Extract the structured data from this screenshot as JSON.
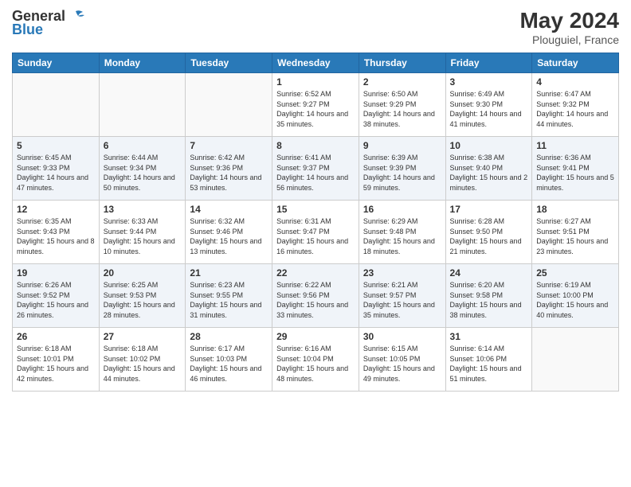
{
  "header": {
    "logo_general": "General",
    "logo_blue": "Blue",
    "month_year": "May 2024",
    "location": "Plouguiel, France"
  },
  "weekdays": [
    "Sunday",
    "Monday",
    "Tuesday",
    "Wednesday",
    "Thursday",
    "Friday",
    "Saturday"
  ],
  "weeks": [
    [
      {
        "day": "",
        "info": ""
      },
      {
        "day": "",
        "info": ""
      },
      {
        "day": "",
        "info": ""
      },
      {
        "day": "1",
        "info": "Sunrise: 6:52 AM\nSunset: 9:27 PM\nDaylight: 14 hours and 35 minutes."
      },
      {
        "day": "2",
        "info": "Sunrise: 6:50 AM\nSunset: 9:29 PM\nDaylight: 14 hours and 38 minutes."
      },
      {
        "day": "3",
        "info": "Sunrise: 6:49 AM\nSunset: 9:30 PM\nDaylight: 14 hours and 41 minutes."
      },
      {
        "day": "4",
        "info": "Sunrise: 6:47 AM\nSunset: 9:32 PM\nDaylight: 14 hours and 44 minutes."
      }
    ],
    [
      {
        "day": "5",
        "info": "Sunrise: 6:45 AM\nSunset: 9:33 PM\nDaylight: 14 hours and 47 minutes."
      },
      {
        "day": "6",
        "info": "Sunrise: 6:44 AM\nSunset: 9:34 PM\nDaylight: 14 hours and 50 minutes."
      },
      {
        "day": "7",
        "info": "Sunrise: 6:42 AM\nSunset: 9:36 PM\nDaylight: 14 hours and 53 minutes."
      },
      {
        "day": "8",
        "info": "Sunrise: 6:41 AM\nSunset: 9:37 PM\nDaylight: 14 hours and 56 minutes."
      },
      {
        "day": "9",
        "info": "Sunrise: 6:39 AM\nSunset: 9:39 PM\nDaylight: 14 hours and 59 minutes."
      },
      {
        "day": "10",
        "info": "Sunrise: 6:38 AM\nSunset: 9:40 PM\nDaylight: 15 hours and 2 minutes."
      },
      {
        "day": "11",
        "info": "Sunrise: 6:36 AM\nSunset: 9:41 PM\nDaylight: 15 hours and 5 minutes."
      }
    ],
    [
      {
        "day": "12",
        "info": "Sunrise: 6:35 AM\nSunset: 9:43 PM\nDaylight: 15 hours and 8 minutes."
      },
      {
        "day": "13",
        "info": "Sunrise: 6:33 AM\nSunset: 9:44 PM\nDaylight: 15 hours and 10 minutes."
      },
      {
        "day": "14",
        "info": "Sunrise: 6:32 AM\nSunset: 9:46 PM\nDaylight: 15 hours and 13 minutes."
      },
      {
        "day": "15",
        "info": "Sunrise: 6:31 AM\nSunset: 9:47 PM\nDaylight: 15 hours and 16 minutes."
      },
      {
        "day": "16",
        "info": "Sunrise: 6:29 AM\nSunset: 9:48 PM\nDaylight: 15 hours and 18 minutes."
      },
      {
        "day": "17",
        "info": "Sunrise: 6:28 AM\nSunset: 9:50 PM\nDaylight: 15 hours and 21 minutes."
      },
      {
        "day": "18",
        "info": "Sunrise: 6:27 AM\nSunset: 9:51 PM\nDaylight: 15 hours and 23 minutes."
      }
    ],
    [
      {
        "day": "19",
        "info": "Sunrise: 6:26 AM\nSunset: 9:52 PM\nDaylight: 15 hours and 26 minutes."
      },
      {
        "day": "20",
        "info": "Sunrise: 6:25 AM\nSunset: 9:53 PM\nDaylight: 15 hours and 28 minutes."
      },
      {
        "day": "21",
        "info": "Sunrise: 6:23 AM\nSunset: 9:55 PM\nDaylight: 15 hours and 31 minutes."
      },
      {
        "day": "22",
        "info": "Sunrise: 6:22 AM\nSunset: 9:56 PM\nDaylight: 15 hours and 33 minutes."
      },
      {
        "day": "23",
        "info": "Sunrise: 6:21 AM\nSunset: 9:57 PM\nDaylight: 15 hours and 35 minutes."
      },
      {
        "day": "24",
        "info": "Sunrise: 6:20 AM\nSunset: 9:58 PM\nDaylight: 15 hours and 38 minutes."
      },
      {
        "day": "25",
        "info": "Sunrise: 6:19 AM\nSunset: 10:00 PM\nDaylight: 15 hours and 40 minutes."
      }
    ],
    [
      {
        "day": "26",
        "info": "Sunrise: 6:18 AM\nSunset: 10:01 PM\nDaylight: 15 hours and 42 minutes."
      },
      {
        "day": "27",
        "info": "Sunrise: 6:18 AM\nSunset: 10:02 PM\nDaylight: 15 hours and 44 minutes."
      },
      {
        "day": "28",
        "info": "Sunrise: 6:17 AM\nSunset: 10:03 PM\nDaylight: 15 hours and 46 minutes."
      },
      {
        "day": "29",
        "info": "Sunrise: 6:16 AM\nSunset: 10:04 PM\nDaylight: 15 hours and 48 minutes."
      },
      {
        "day": "30",
        "info": "Sunrise: 6:15 AM\nSunset: 10:05 PM\nDaylight: 15 hours and 49 minutes."
      },
      {
        "day": "31",
        "info": "Sunrise: 6:14 AM\nSunset: 10:06 PM\nDaylight: 15 hours and 51 minutes."
      },
      {
        "day": "",
        "info": ""
      }
    ]
  ]
}
